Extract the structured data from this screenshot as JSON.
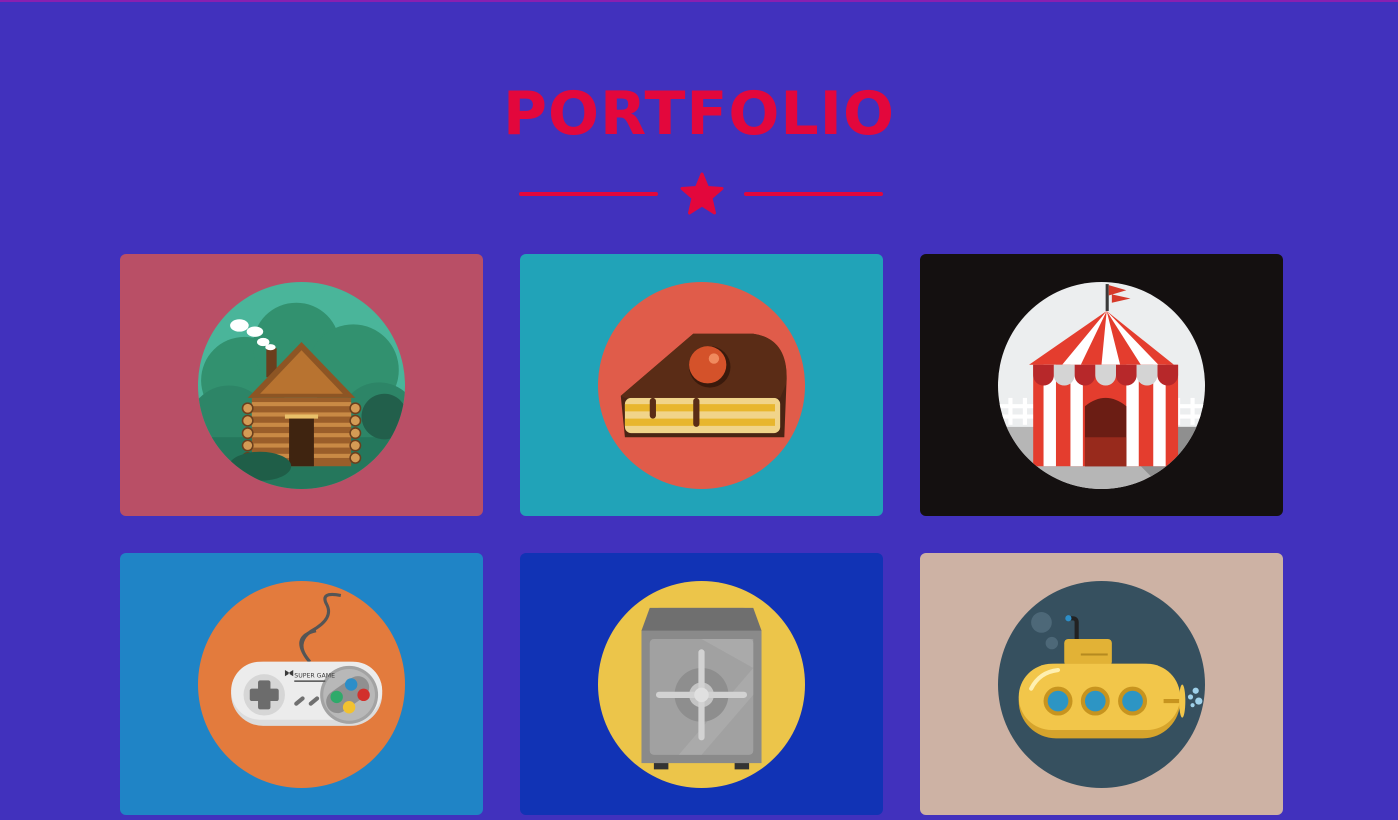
{
  "section": {
    "title": "PORTFOLIO",
    "accent_color": "#e3073c",
    "background_color": "#4131bd",
    "divider_icon": "star-icon"
  },
  "portfolio": {
    "items": [
      {
        "icon": "log-cabin-icon",
        "bg": "#b94f66",
        "circle": "#2e8a6c"
      },
      {
        "icon": "cake-slice-icon",
        "bg": "#21a3b8",
        "circle": "#e05c4a"
      },
      {
        "icon": "circus-tent-icon",
        "bg": "#141010",
        "circle": "#eeeeee"
      },
      {
        "icon": "game-controller-icon",
        "bg": "#1f84c6",
        "circle": "#e37b3d"
      },
      {
        "icon": "safe-icon",
        "bg": "#1133b5",
        "circle": "#ecc54a"
      },
      {
        "icon": "submarine-icon",
        "bg": "#cdb2a4",
        "circle": "#36505f"
      }
    ]
  },
  "controller_label": "SUPER GAME"
}
